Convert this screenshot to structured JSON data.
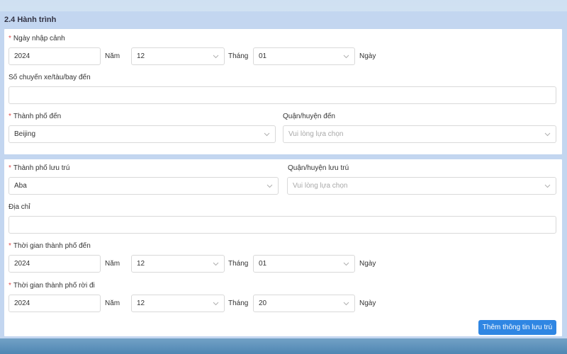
{
  "section": {
    "title": "2.4 Hành trình"
  },
  "entry_date": {
    "label": "Ngày nhập cảnh",
    "year": "2024",
    "year_unit": "Năm",
    "month": "12",
    "month_unit": "Tháng",
    "day": "01",
    "day_unit": "Ngày"
  },
  "flight_number": {
    "label": "Số chuyến xe/tàu/bay đến",
    "value": ""
  },
  "arrival_city": {
    "label": "Thành phố đến",
    "value": "Beijing"
  },
  "arrival_district": {
    "label": "Quận/huyện đến",
    "placeholder": "Vui lòng lựa chọn"
  },
  "stay_city": {
    "label": "Thành phố lưu trú",
    "value": "Aba"
  },
  "stay_district": {
    "label": "Quận/huyện lưu trú",
    "placeholder": "Vui lòng lựa chọn"
  },
  "address": {
    "label": "Địa chỉ",
    "value": ""
  },
  "arrive_city_time": {
    "label": "Thời gian thành phố đến",
    "year": "2024",
    "year_unit": "Năm",
    "month": "12",
    "month_unit": "Tháng",
    "day": "01",
    "day_unit": "Ngày"
  },
  "leave_city_time": {
    "label": "Thời gian thành phố rời đi",
    "year": "2024",
    "year_unit": "Năm",
    "month": "12",
    "month_unit": "Tháng",
    "day": "20",
    "day_unit": "Ngày"
  },
  "add_button": {
    "label": "Thêm thông tin lưu trú"
  },
  "required_mark": "*",
  "colors": {
    "accent": "#2f86e3",
    "required": "#e04848",
    "frame": "#c3d6f0"
  }
}
